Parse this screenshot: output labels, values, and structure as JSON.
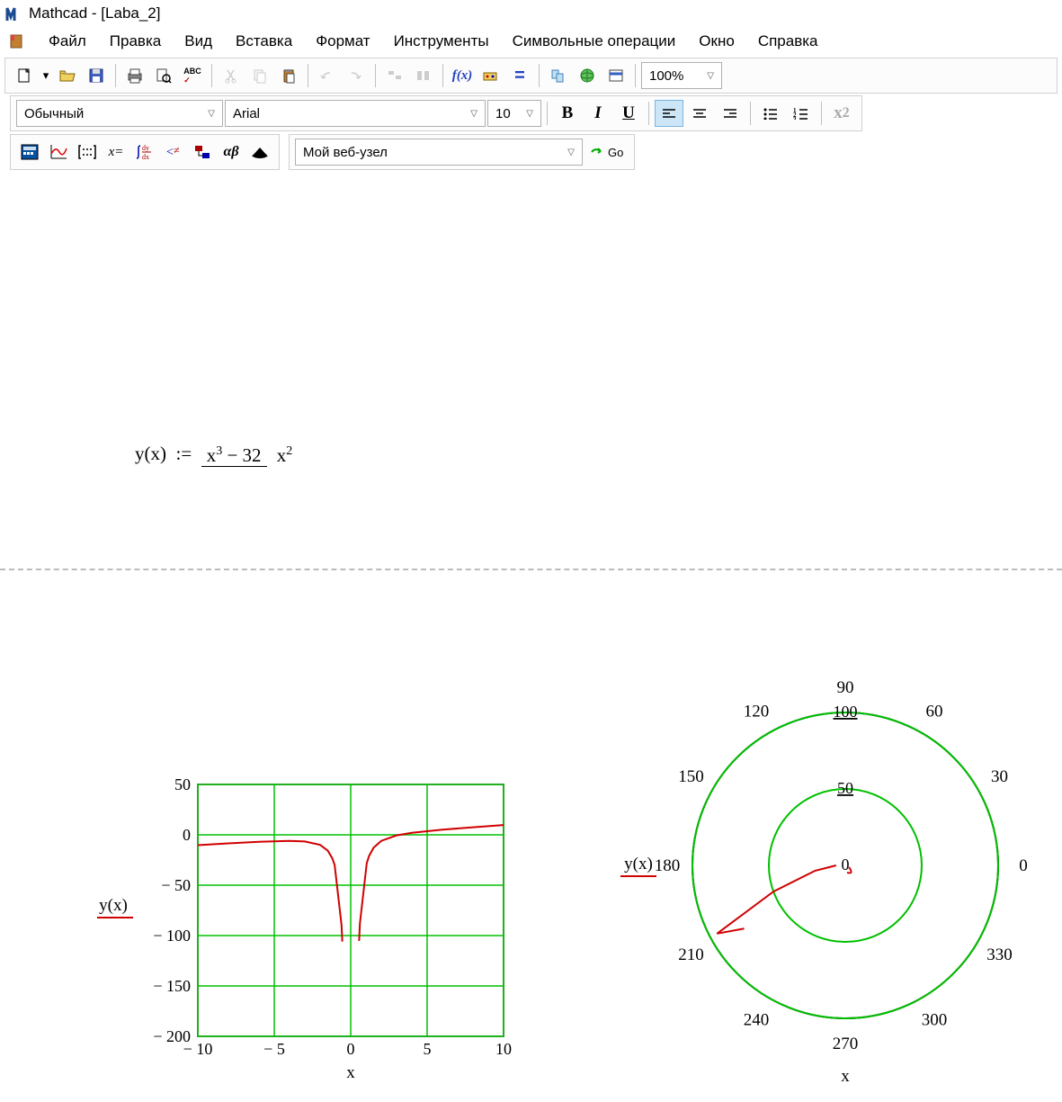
{
  "titlebar": {
    "text": "Mathcad - [Laba_2]"
  },
  "menubar": {
    "items": [
      "Файл",
      "Правка",
      "Вид",
      "Вставка",
      "Формат",
      "Инструменты",
      "Символьные операции",
      "Окно",
      "Справка"
    ]
  },
  "toolbar1": {
    "zoom": "100%"
  },
  "toolbar2": {
    "style": "Обычный",
    "font": "Arial",
    "size": "10"
  },
  "toolbar3": {
    "websel": "Мой веб-узел",
    "go": "Go"
  },
  "formula": {
    "lhs": "y(x)",
    "assign": ":=",
    "num_var": "x",
    "num_pow": "3",
    "num_op": " − 32",
    "den_var": "x",
    "den_pow": "2"
  },
  "chart_data": [
    {
      "type": "line",
      "title": "",
      "xlabel": "x",
      "ylabel": "y(x)",
      "xlim": [
        -10,
        10
      ],
      "ylim": [
        -200,
        50
      ],
      "xticks": [
        -10,
        -5,
        0,
        5,
        10
      ],
      "yticks": [
        -200,
        -150,
        -100,
        -50,
        0,
        50
      ],
      "grid": true,
      "grid_color": "#00c000",
      "series": [
        {
          "name": "y(x)",
          "color": "#d00000",
          "x": [
            -10,
            -8,
            -6,
            -4,
            -3,
            -2,
            -1.5,
            -1.2,
            -1.05,
            -0.6,
            -0.55,
            0.55,
            0.6,
            1.05,
            1.2,
            1.5,
            2,
            3,
            4,
            6,
            8,
            10
          ],
          "y": [
            -10.32,
            -8.5,
            -6.89,
            -6,
            -6.56,
            -10,
            -15.72,
            -23.42,
            -29.98,
            -89.49,
            -105.94,
            -105.28,
            -88.29,
            -28.08,
            -21.02,
            -12.72,
            -6,
            -0.56,
            2,
            5.11,
            7.5,
            9.68
          ]
        }
      ]
    },
    {
      "type": "polar",
      "title": "",
      "xlabel": "x",
      "ylabel": "y(x)",
      "rlim": [
        0,
        100
      ],
      "rticks": [
        0,
        50,
        100
      ],
      "angle_ticks": [
        0,
        30,
        60,
        90,
        120,
        150,
        180,
        210,
        240,
        270,
        300,
        330
      ],
      "grid_color": "#00c000",
      "series": [
        {
          "name": "y(x)",
          "color": "#d00000",
          "angles_deg": [
            180,
            190,
            200,
            208,
            212
          ],
          "r": [
            6,
            20,
            50,
            95,
            78
          ]
        }
      ]
    }
  ]
}
